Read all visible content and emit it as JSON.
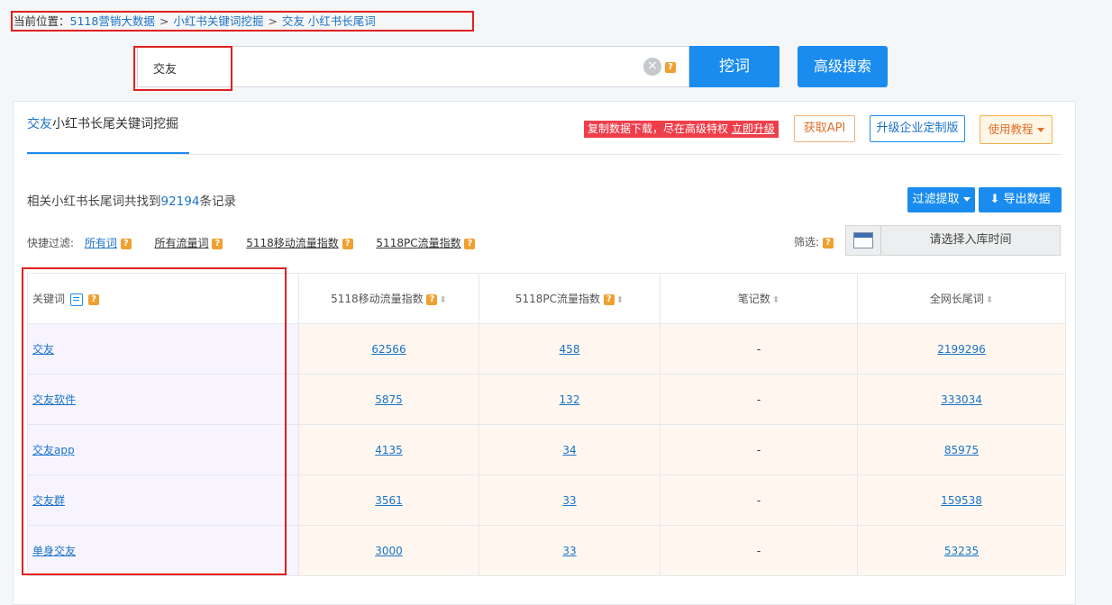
{
  "breadcrumb": {
    "label": "当前位置：",
    "items": [
      "5118营销大数据",
      "小红书关键词挖掘",
      "交友 小红书长尾词"
    ],
    "separator": ">"
  },
  "search": {
    "value": "交友",
    "dig_label": "挖词",
    "advanced_label": "高级搜索"
  },
  "tab": {
    "keyword": "交友",
    "title_rest": "小红书长尾关键词挖掘"
  },
  "toolbar": {
    "promo_text": "复制数据下载，尽在高级特权",
    "promo_link": "立即升级",
    "api_label": "获取API",
    "enterprise_label": "升级企业定制版",
    "tutorial_label": "使用教程"
  },
  "summary": {
    "prefix": "相关小红书长尾词共找到",
    "count": "92194",
    "suffix": "条记录"
  },
  "actions": {
    "filter_label": "过滤提取",
    "export_label": "导出数据"
  },
  "quick_filter": {
    "label": "快捷过滤:",
    "items": [
      "所有词",
      "所有流量词",
      "5118移动流量指数",
      "5118PC流量指数"
    ]
  },
  "screen": {
    "label": "筛选:",
    "date_placeholder": "请选择入库时间"
  },
  "table": {
    "headers": [
      "关键词",
      "5118移动流量指数",
      "5118PC流量指数",
      "笔记数",
      "全网长尾词"
    ],
    "rows": [
      [
        "交友",
        "62566",
        "458",
        "-",
        "2199296"
      ],
      [
        "交友软件",
        "5875",
        "132",
        "-",
        "333034"
      ],
      [
        "交友app",
        "4135",
        "34",
        "-",
        "85975"
      ],
      [
        "交友群",
        "3561",
        "33",
        "-",
        "159538"
      ],
      [
        "单身交友",
        "3000",
        "33",
        "-",
        "53235"
      ]
    ]
  },
  "colors": {
    "accent": "#1a8cf0",
    "highlight": "#e02020",
    "promo": "#ef3e4a",
    "warn": "#f0a030"
  }
}
